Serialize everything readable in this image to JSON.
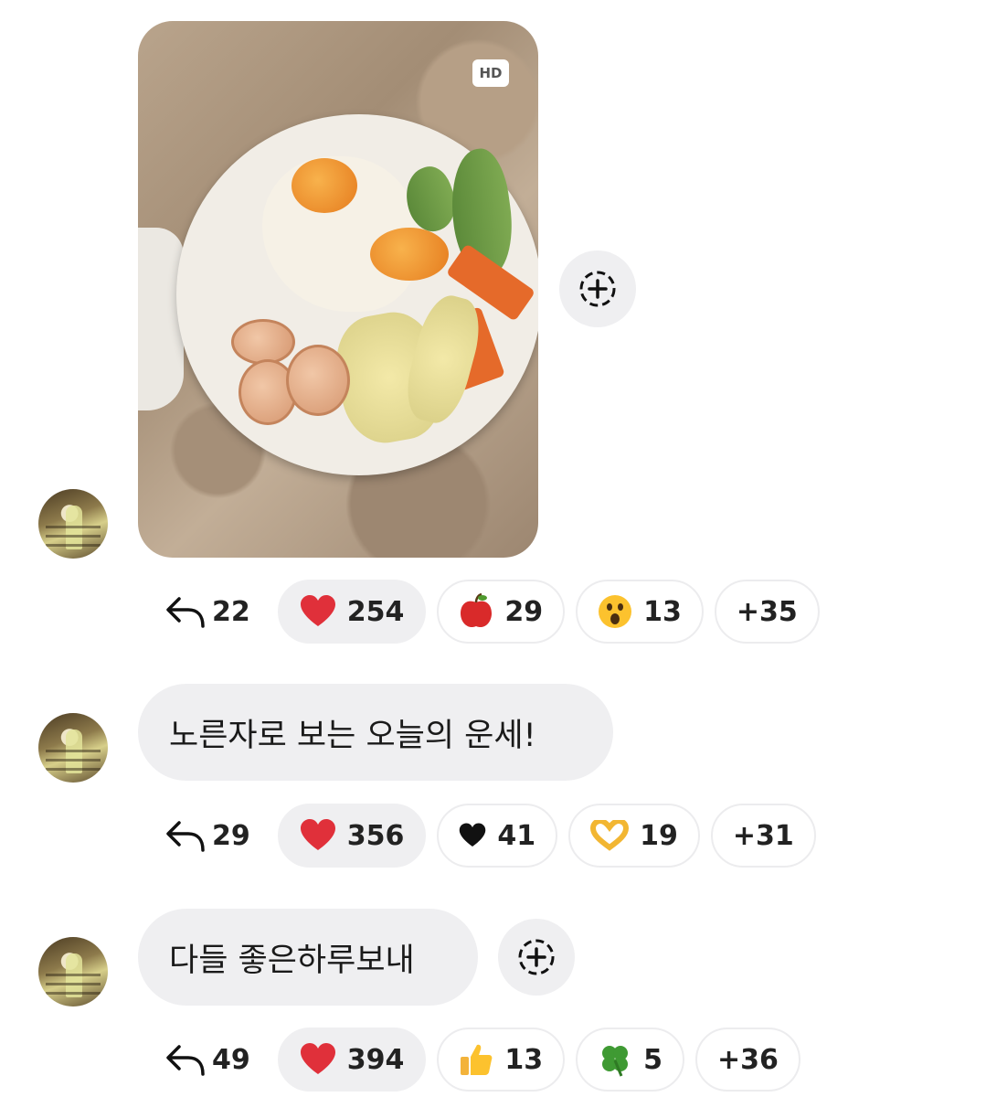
{
  "photo_message": {
    "hd_label": "HD",
    "reply_count": "22",
    "reactions": [
      {
        "icon": "red-heart",
        "count": "254"
      },
      {
        "icon": "red-apple",
        "count": "29"
      },
      {
        "icon": "surprised-face",
        "count": "13"
      }
    ],
    "more": "+35"
  },
  "message_1": {
    "text": "노른자로 보는 오늘의 운세!",
    "reply_count": "29",
    "reactions": [
      {
        "icon": "red-heart",
        "count": "356"
      },
      {
        "icon": "black-heart",
        "count": "41"
      },
      {
        "icon": "heart-hands",
        "count": "19"
      }
    ],
    "more": "+31"
  },
  "message_2": {
    "text": "다들 좋은하루보내",
    "reply_count": "49",
    "reactions": [
      {
        "icon": "thumbs-up",
        "count": "394"
      },
      {
        "icon": "thumbs-up",
        "count": "13"
      },
      {
        "icon": "four-leaf-clover",
        "count": "5"
      }
    ],
    "more": "+36"
  },
  "colors": {
    "bubble": "#efeff1",
    "heart": "#e0303a",
    "text": "#1a1a1a"
  }
}
